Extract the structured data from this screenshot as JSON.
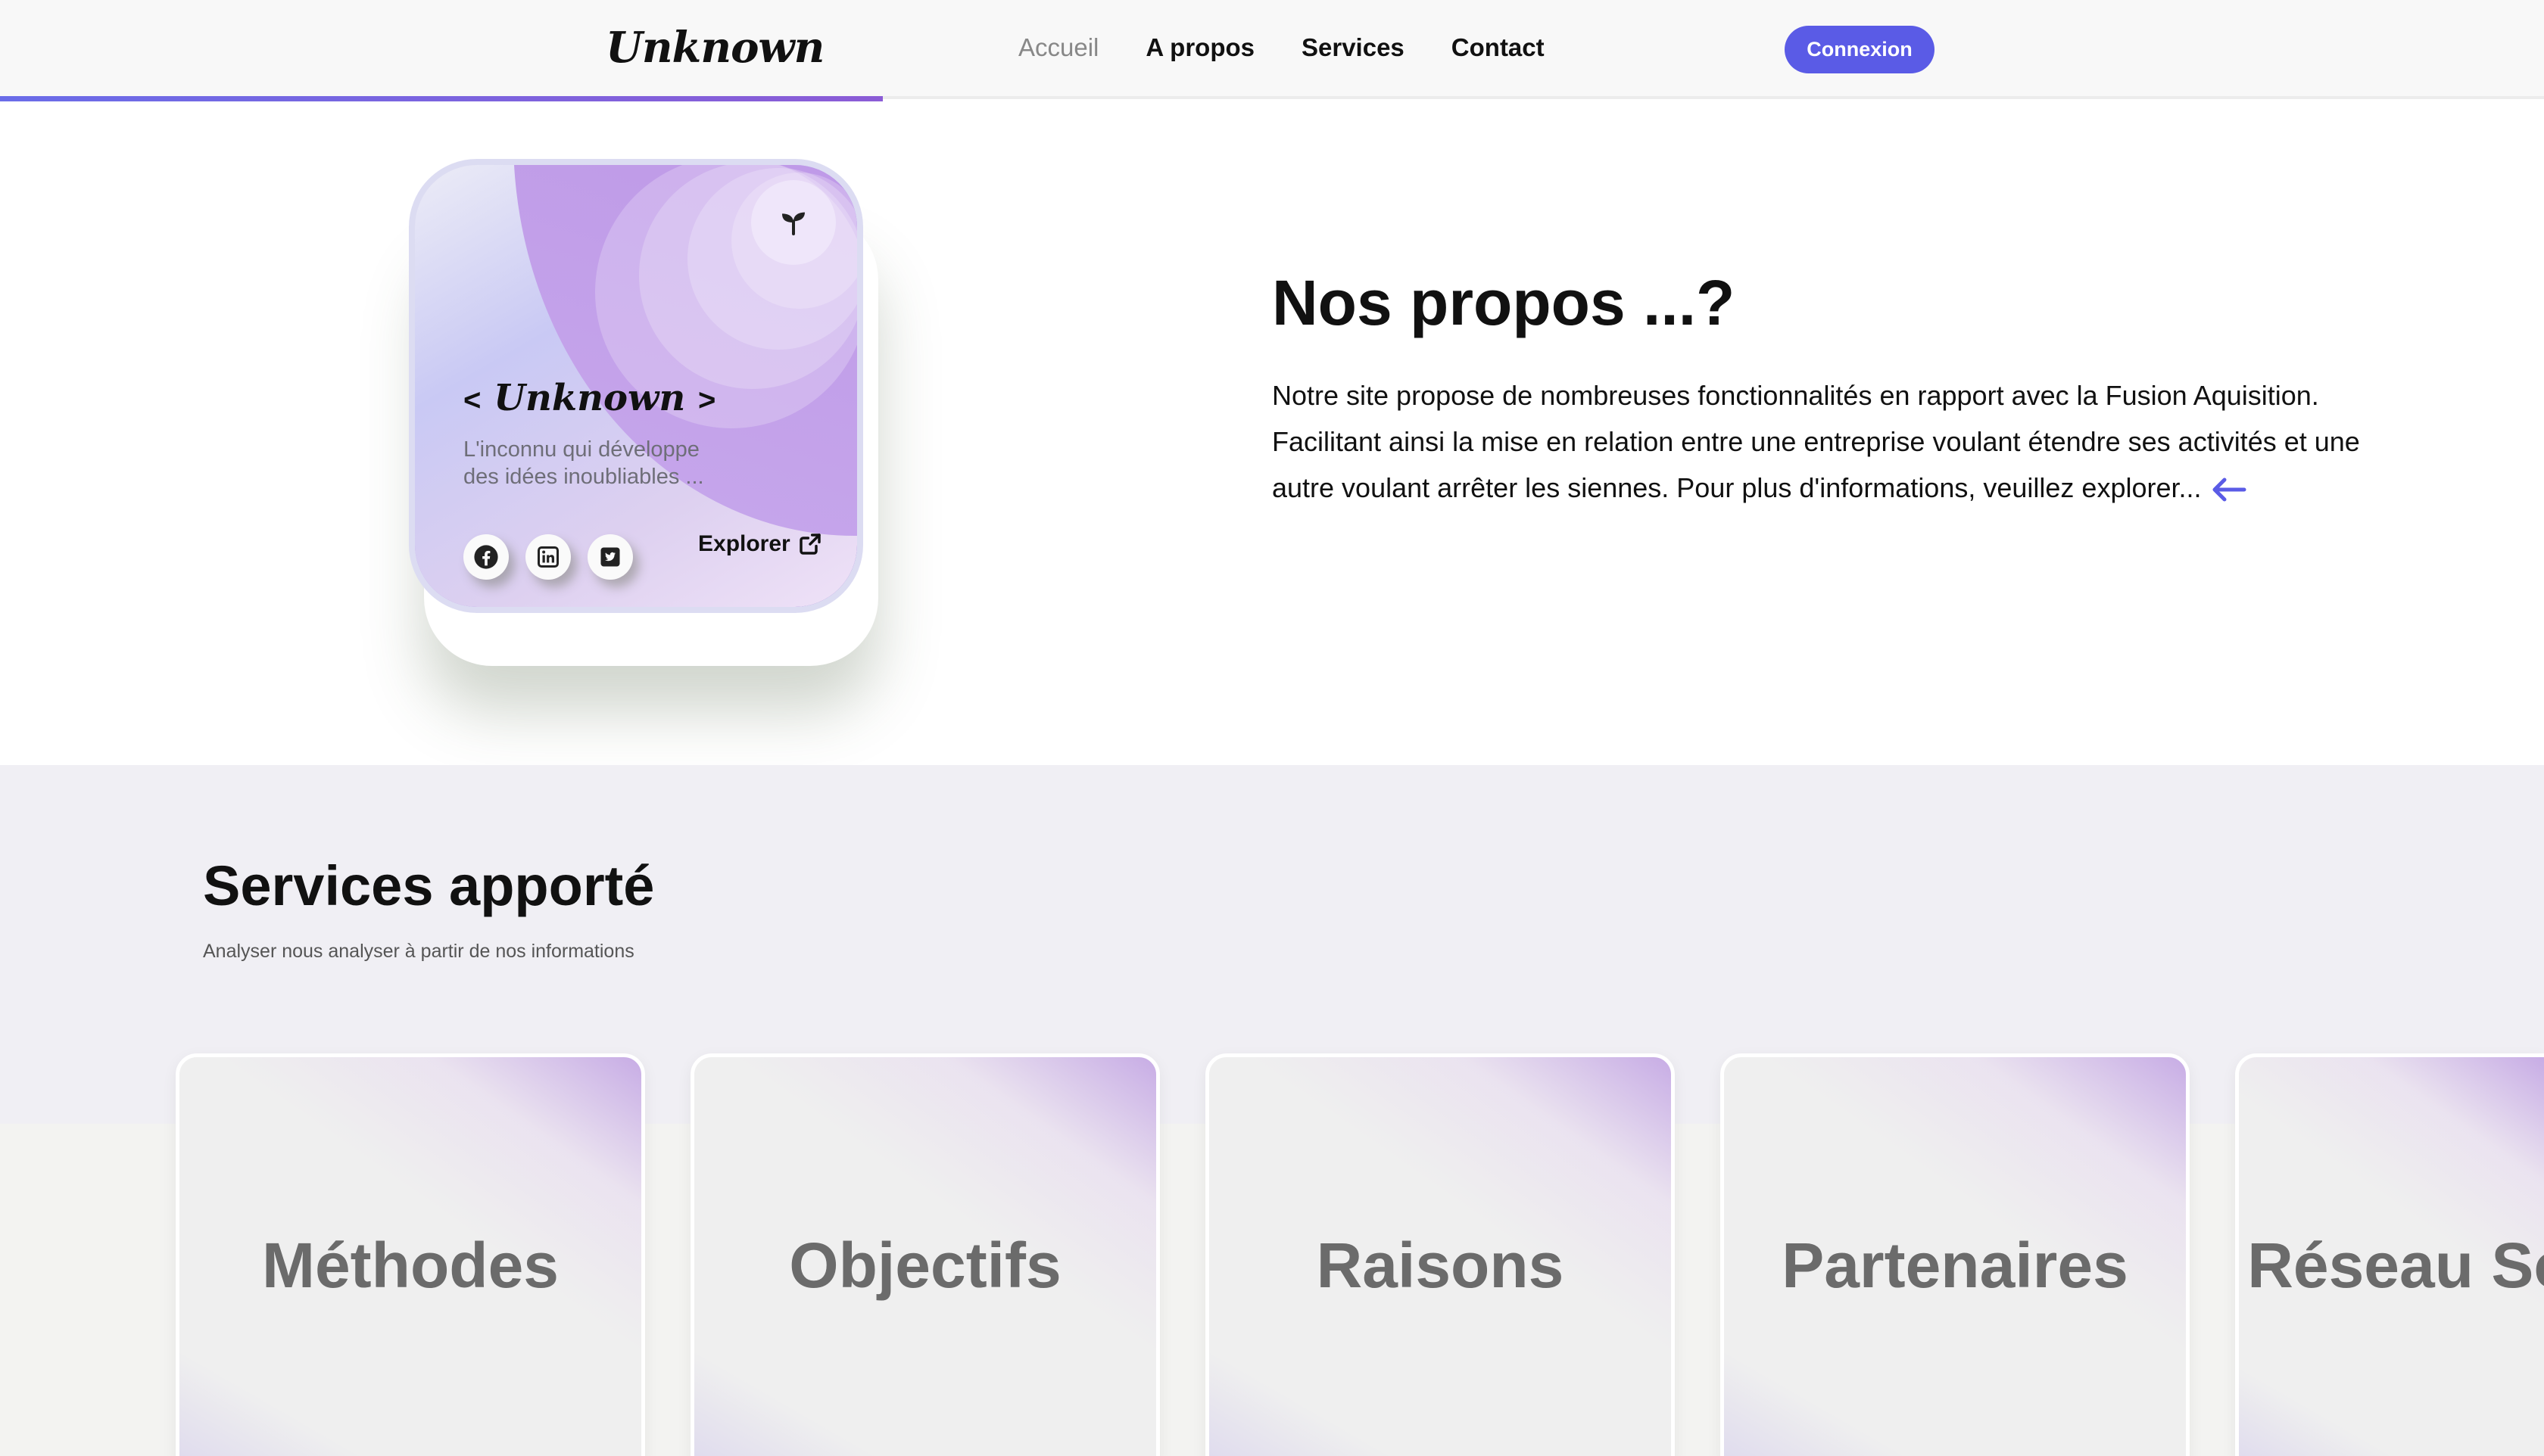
{
  "nav": {
    "logo": "Unknown",
    "links": [
      "Accueil",
      "A propos",
      "Services",
      "Contact"
    ],
    "active_index": 0,
    "login": "Connexion",
    "scroll_progress_pct": 34.7
  },
  "hero_card": {
    "title_open": "<",
    "title_name": "Unknown",
    "title_close": ">",
    "description": "L'inconnu qui développe des idées inoubliables ...",
    "explore": "Explorer",
    "icons": [
      "leaf-icon",
      "facebook-icon",
      "linkedin-icon",
      "twitter-icon",
      "external-link-icon"
    ]
  },
  "propos": {
    "title": "Nos propos ...?",
    "text": "Notre site propose de nombreuses fonctionnalités en rapport avec la Fusion Aquisition. Facilitant ainsi la mise en relation entre une entreprise voulant étendre ses activités et une autre voulant arrêter les siennes. Pour plus d'informations, veuillez explorer..."
  },
  "services": {
    "title": "Services apporté",
    "subtitle": "Analyser nous analyser à partir de nos informations",
    "cards": [
      "Méthodes",
      "Objectifs",
      "Raisons",
      "Partenaires",
      "Réseau Sociau"
    ]
  },
  "colors": {
    "accent": "#5a5be6",
    "card_purple": "#9b6ee0"
  }
}
